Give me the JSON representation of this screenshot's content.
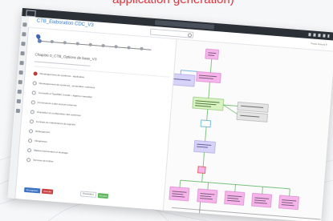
{
  "headline": "application generation)",
  "app": {
    "title": "CTB_Elaboration CDC_V3",
    "user_text": "Frank Dubois ▾"
  },
  "step_title": "Chapitre 0_CTB_Options de base_V3",
  "options": [
    {
      "label": "Développement de systèmes - application",
      "selected": true
    },
    {
      "label": "Développement de systèmes - ensembles multi-tiers",
      "selected": false
    },
    {
      "label": "Correctifs et TypeDEC (modèl. / algèbre manuelle)",
      "selected": false
    },
    {
      "label": "Connecteurs à des sources externes",
      "selected": false
    },
    {
      "label": "Acquisition et configuration des systèmes",
      "selected": false
    },
    {
      "label": "Contrats de maintenance de logiciels",
      "selected": false
    },
    {
      "label": "Hébergement",
      "selected": false
    },
    {
      "label": "Infogérance",
      "selected": false
    },
    {
      "label": "Matériel (terminaux) et stockage",
      "selected": false
    },
    {
      "label": "Services de hotline",
      "selected": false
    }
  ],
  "buttons": {
    "primary": "Enregistrer",
    "cancel": "Annuler",
    "previous": "Précédent",
    "next": "Suivant"
  },
  "colors": {
    "accent_blue": "#3b73c4",
    "danger_red": "#c94141",
    "success_green": "#5cb85c",
    "headline_red": "#e53c42",
    "node_green": "#d8f2c2",
    "node_pink": "#f7b4ea",
    "node_violet": "#d6d2f8"
  },
  "icons": [
    "home-icon",
    "grid-icon",
    "user-icon",
    "chart-icon",
    "document-icon",
    "calendar-icon",
    "cart-icon",
    "list-icon",
    "tag-icon",
    "settings-icon"
  ]
}
